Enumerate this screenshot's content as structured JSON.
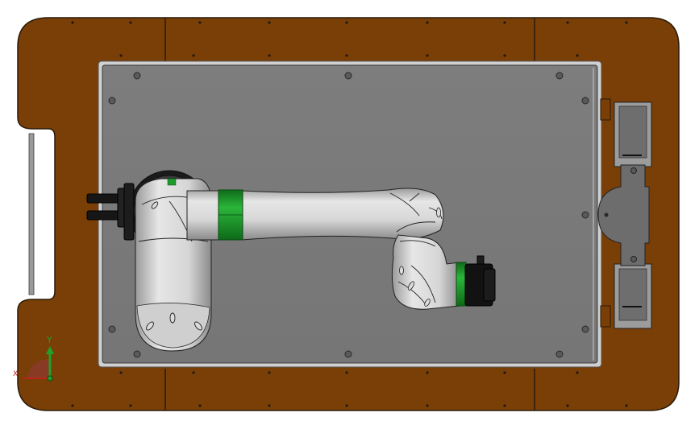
{
  "view": {
    "triad": {
      "x_label": "X",
      "y_label": "Y"
    }
  },
  "colors": {
    "background": "#ffffff",
    "frame_wood": "#7a3f07",
    "frame_edge": "#2a1a08",
    "base_plate": "#7a7a7a",
    "plate_edge": "#c9c9c9",
    "robot_body": "#d4d4d4",
    "robot_shadow": "#8e8e8e",
    "joint_ring": "#1f9a2c",
    "end_effector": "#111111",
    "triad_y": "#1fa12a",
    "triad_x": "#c81e1e",
    "triad_origin": "#8b3a2a"
  }
}
